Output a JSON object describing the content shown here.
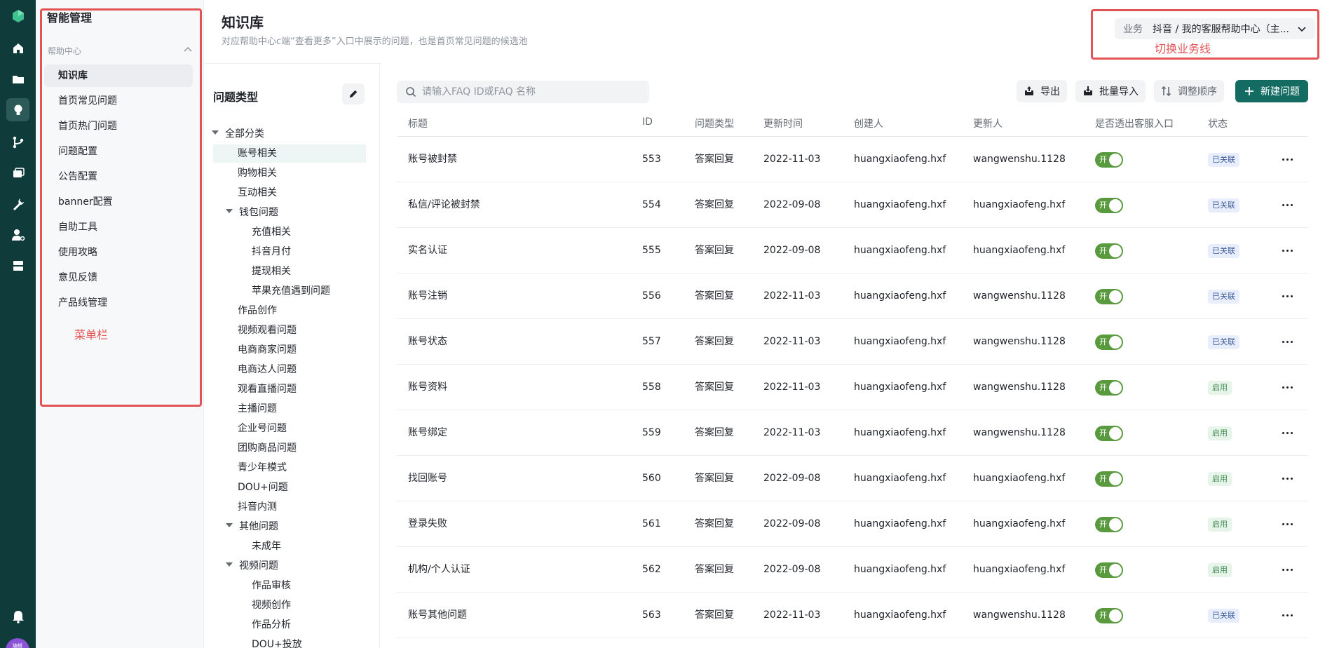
{
  "rail": {
    "avatar_text": "编辑"
  },
  "menu": {
    "title": "智能管理",
    "group_label": "帮助中心",
    "items": [
      {
        "label": "知识库",
        "active": true
      },
      {
        "label": "首页常见问题"
      },
      {
        "label": "首页热门问题"
      },
      {
        "label": "问题配置"
      },
      {
        "label": "公告配置"
      },
      {
        "label": "banner配置"
      },
      {
        "label": "自助工具"
      },
      {
        "label": "使用攻略"
      },
      {
        "label": "意见反馈"
      },
      {
        "label": "产品线管理"
      }
    ],
    "annotation": "菜单栏"
  },
  "header": {
    "title": "知识库",
    "subtitle": "对应帮助中心c端“查看更多”入口中展示的问题，也是首页常见问题的候选池",
    "biz_label": "业务",
    "biz_value": "抖音 / 我的客服帮助中心（主...",
    "biz_annotation": "切换业务线"
  },
  "tree": {
    "title": "问题类型",
    "nodes": [
      {
        "label": "全部分类",
        "level": 0,
        "caret": true
      },
      {
        "label": "账号相关",
        "level": 1,
        "selected": true
      },
      {
        "label": "购物相关",
        "level": 1
      },
      {
        "label": "互动相关",
        "level": 1
      },
      {
        "label": "钱包问题",
        "level": 1,
        "caret": true
      },
      {
        "label": "充值相关",
        "level": 2
      },
      {
        "label": "抖音月付",
        "level": 2
      },
      {
        "label": "提现相关",
        "level": 2
      },
      {
        "label": "苹果充值遇到问题",
        "level": 2
      },
      {
        "label": "作品创作",
        "level": 1
      },
      {
        "label": "视频观看问题",
        "level": 1
      },
      {
        "label": "电商商家问题",
        "level": 1
      },
      {
        "label": "电商达人问题",
        "level": 1
      },
      {
        "label": "观看直播问题",
        "level": 1
      },
      {
        "label": "主播问题",
        "level": 1
      },
      {
        "label": "企业号问题",
        "level": 1
      },
      {
        "label": "团购商品问题",
        "level": 1
      },
      {
        "label": "青少年模式",
        "level": 1
      },
      {
        "label": "DOU+问题",
        "level": 1
      },
      {
        "label": "抖音内测",
        "level": 1
      },
      {
        "label": "其他问题",
        "level": 1,
        "caret": true
      },
      {
        "label": "未成年",
        "level": 2
      },
      {
        "label": "视频问题",
        "level": 1,
        "caret": true
      },
      {
        "label": "作品审核",
        "level": 2
      },
      {
        "label": "视频创作",
        "level": 2
      },
      {
        "label": "作品分析",
        "level": 2
      },
      {
        "label": "DOU+投放",
        "level": 2
      }
    ]
  },
  "toolbar": {
    "search_placeholder": "请输入FAQ ID或FAQ 名称",
    "export_label": "导出",
    "import_label": "批量导入",
    "reorder_label": "调整顺序",
    "new_label": "新建问题"
  },
  "table": {
    "columns": [
      "标题",
      "ID",
      "问题类型",
      "更新时间",
      "创建人",
      "更新人",
      "是否透出客服入口",
      "状态"
    ],
    "toggle_on_text": "开",
    "rows": [
      {
        "title": "账号被封禁",
        "id": "553",
        "type": "答案回复",
        "updated": "2022-11-03",
        "creator": "huangxiaofeng.hxf",
        "updater": "wangwenshu.1128",
        "status": "已关联",
        "status_kind": "linked"
      },
      {
        "title": "私信/评论被封禁",
        "id": "554",
        "type": "答案回复",
        "updated": "2022-09-08",
        "creator": "huangxiaofeng.hxf",
        "updater": "huangxiaofeng.hxf",
        "status": "已关联",
        "status_kind": "linked"
      },
      {
        "title": "实名认证",
        "id": "555",
        "type": "答案回复",
        "updated": "2022-09-08",
        "creator": "huangxiaofeng.hxf",
        "updater": "huangxiaofeng.hxf",
        "status": "已关联",
        "status_kind": "linked"
      },
      {
        "title": "账号注销",
        "id": "556",
        "type": "答案回复",
        "updated": "2022-11-03",
        "creator": "huangxiaofeng.hxf",
        "updater": "wangwenshu.1128",
        "status": "已关联",
        "status_kind": "linked"
      },
      {
        "title": "账号状态",
        "id": "557",
        "type": "答案回复",
        "updated": "2022-11-03",
        "creator": "huangxiaofeng.hxf",
        "updater": "wangwenshu.1128",
        "status": "已关联",
        "status_kind": "linked"
      },
      {
        "title": "账号资料",
        "id": "558",
        "type": "答案回复",
        "updated": "2022-11-03",
        "creator": "huangxiaofeng.hxf",
        "updater": "wangwenshu.1128",
        "status": "启用",
        "status_kind": "enabled"
      },
      {
        "title": "账号绑定",
        "id": "559",
        "type": "答案回复",
        "updated": "2022-11-03",
        "creator": "huangxiaofeng.hxf",
        "updater": "wangwenshu.1128",
        "status": "启用",
        "status_kind": "enabled"
      },
      {
        "title": "找回账号",
        "id": "560",
        "type": "答案回复",
        "updated": "2022-09-08",
        "creator": "huangxiaofeng.hxf",
        "updater": "huangxiaofeng.hxf",
        "status": "启用",
        "status_kind": "enabled"
      },
      {
        "title": "登录失败",
        "id": "561",
        "type": "答案回复",
        "updated": "2022-09-08",
        "creator": "huangxiaofeng.hxf",
        "updater": "huangxiaofeng.hxf",
        "status": "启用",
        "status_kind": "enabled"
      },
      {
        "title": "机构/个人认证",
        "id": "562",
        "type": "答案回复",
        "updated": "2022-09-08",
        "creator": "huangxiaofeng.hxf",
        "updater": "huangxiaofeng.hxf",
        "status": "启用",
        "status_kind": "enabled"
      },
      {
        "title": "账号其他问题",
        "id": "563",
        "type": "答案回复",
        "updated": "2022-11-03",
        "creator": "huangxiaofeng.hxf",
        "updater": "wangwenshu.1128",
        "status": "已关联",
        "status_kind": "linked"
      }
    ]
  },
  "colors": {
    "rail_bg": "#0f3b3a",
    "primary": "#136b62",
    "toggle_on": "#5a9a3f",
    "annotation_red": "#e15355"
  }
}
